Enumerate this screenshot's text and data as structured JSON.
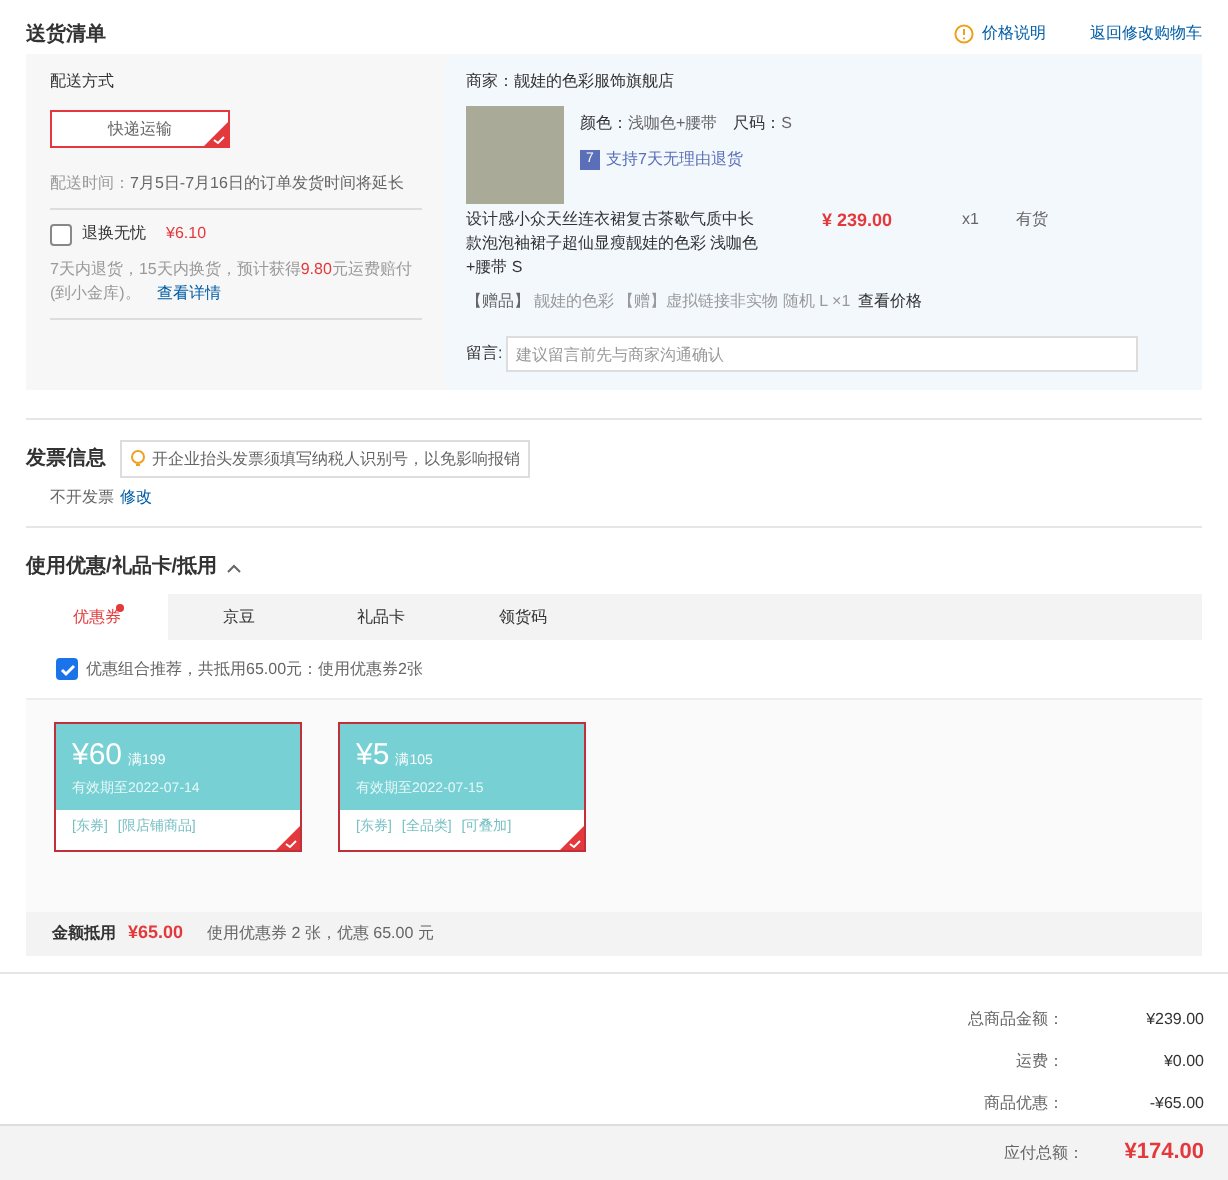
{
  "header": {
    "title": "送货清单",
    "links": [
      "价格说明",
      "返回修改购物车"
    ]
  },
  "shipping": {
    "label": "配送方式",
    "method": {
      "label": "快递运输",
      "selected": true
    },
    "time_label": "配送时间：",
    "time": "7月5日-7月16日的订单发货时间将延长",
    "insurance": {
      "label": "退换无忧",
      "price": "¥6.10",
      "checked": false
    },
    "insurance_note_a": "7天内退货，15天内换货，预计获得",
    "insurance_amount": "9.80",
    "insurance_note_b": "元运费赔付(到小金库)。",
    "details_link": "查看详情"
  },
  "merchant": {
    "label": "商家：",
    "name": "靓娃的色彩服饰旗舰店"
  },
  "product": {
    "color_label": "颜色：",
    "color_name": "浅咖色+腰带",
    "size_label": "尺码：",
    "size": "S",
    "return_badge": "7",
    "return_text": "支持7天无理由退货",
    "title": "设计感小众天丝连衣裙复古茶歇气质中长款泡泡袖裙子超仙显瘦靓娃的色彩 浅咖色+腰带 S",
    "price": "¥ 239.00",
    "qty": "x1",
    "stock": "有货",
    "gift_tag": "【赠品】",
    "gift_text": "靓娃的色彩 【赠】虚拟链接非实物 随机 L ×1",
    "gift_link": "查看价格"
  },
  "note": {
    "label": "留言:",
    "placeholder": "建议留言前先与商家沟通确认"
  },
  "invoice": {
    "title": "发票信息",
    "tip": "开企业抬头发票须填写纳税人识别号，以免影响报销",
    "value": "不开发票",
    "edit_link": "修改"
  },
  "discount": {
    "title": "使用优惠/礼品卡/抵用",
    "expanded": true,
    "tabs": [
      {
        "label": "优惠券",
        "selected": true,
        "dot": true
      },
      {
        "label": "京豆",
        "selected": false,
        "dot": false
      },
      {
        "label": "礼品卡",
        "selected": false,
        "dot": false
      },
      {
        "label": "领货码",
        "selected": false,
        "dot": false
      }
    ],
    "combo": {
      "label": "优惠组合推荐，共抵用65.00元：使用优惠券2张",
      "checked": true
    },
    "coupons": [
      {
        "amount": "¥60",
        "condition": "满199",
        "expiry": "有效期至2022-07-14",
        "tags": [
          "[东券]",
          "[限店铺商品]"
        ],
        "selected": true
      },
      {
        "amount": "¥5",
        "condition": "满105",
        "expiry": "有效期至2022-07-15",
        "tags": [
          "[东券]",
          "[全品类]",
          "[可叠加]"
        ],
        "selected": true
      }
    ],
    "summary_label": "金额抵用",
    "summary_amount": "¥65.00",
    "summary_text": "使用优惠券 2 张，优惠 65.00 元"
  },
  "totals": [
    {
      "label": "总商品金额：",
      "value": "¥239.00"
    },
    {
      "label": "运费：",
      "value": "¥0.00"
    },
    {
      "label": "商品优惠：",
      "value": "-¥65.00"
    }
  ],
  "payable": {
    "label": "应付总额：",
    "value": "¥174.00"
  }
}
